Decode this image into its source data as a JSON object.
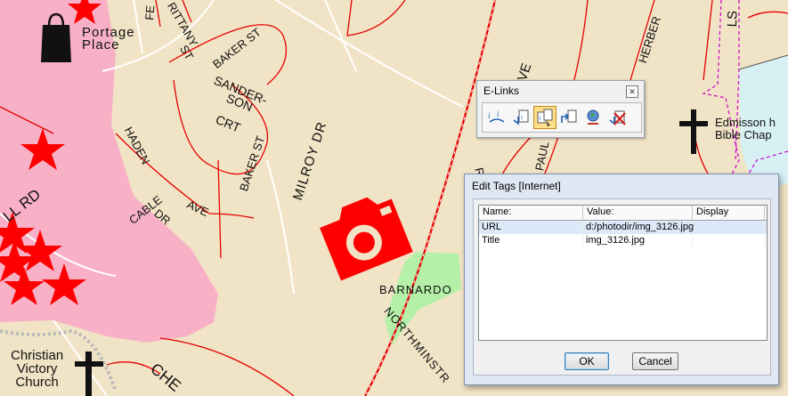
{
  "map": {
    "streets": [
      {
        "id": "fe",
        "text": "FE"
      },
      {
        "id": "brittany",
        "text": "RITTANY"
      },
      {
        "id": "st",
        "text": "ST"
      },
      {
        "id": "baker-st-top",
        "text": "BAKER ST"
      },
      {
        "id": "sanderson",
        "text": "SANDER-"
      },
      {
        "id": "sanderson2",
        "text": "SON"
      },
      {
        "id": "crt",
        "text": "CRT"
      },
      {
        "id": "baker-st-side",
        "text": "BAKER ST"
      },
      {
        "id": "haden",
        "text": "HADEN"
      },
      {
        "id": "ave",
        "text": "AVE"
      },
      {
        "id": "cable",
        "text": "CABLE"
      },
      {
        "id": "dr",
        "text": "DR"
      },
      {
        "id": "milroy",
        "text": "MILROY DR"
      },
      {
        "id": "ve",
        "text": "VE"
      },
      {
        "id": "herber",
        "text": "HERBER"
      },
      {
        "id": "ls",
        "text": "LS"
      },
      {
        "id": "barnardo",
        "text": "BARNARDO"
      },
      {
        "id": "northminster",
        "text": "NORTHMINSTR"
      },
      {
        "id": "rna",
        "text": "RNA"
      },
      {
        "id": "paul",
        "text": "PAUL"
      },
      {
        "id": "ll-rd",
        "text": "LL RD"
      },
      {
        "id": "che",
        "text": "CHE"
      }
    ],
    "places": {
      "portage": [
        "Portage",
        "Place"
      ],
      "edmisson": [
        "Edmisson h",
        "Bible Chap"
      ],
      "christian": [
        "Christian",
        "Victory",
        "Church"
      ]
    },
    "colors": {
      "land": "#f1e4c6",
      "park": "#f7b0c6",
      "green": "#b4f0a8",
      "water": "#d7f0f4",
      "road": "#e60000",
      "poi": "#ff0000"
    }
  },
  "elinks": {
    "title": "E-Links",
    "tools": [
      "link-icon",
      "attach-doc-icon",
      "edit-tags-icon",
      "open-link-icon",
      "globe-icon",
      "remove-link-icon"
    ],
    "active_tool": 2
  },
  "edit_tags": {
    "title": "Edit Tags [Internet]",
    "columns": [
      "Name:",
      "Value:",
      "Display"
    ],
    "rows": [
      {
        "name": "URL",
        "value": "d:/photodir/img_3126.jpg",
        "display": ""
      },
      {
        "name": "Title",
        "value": "img_3126.jpg",
        "display": ""
      }
    ],
    "ok_label": "OK",
    "cancel_label": "Cancel"
  }
}
